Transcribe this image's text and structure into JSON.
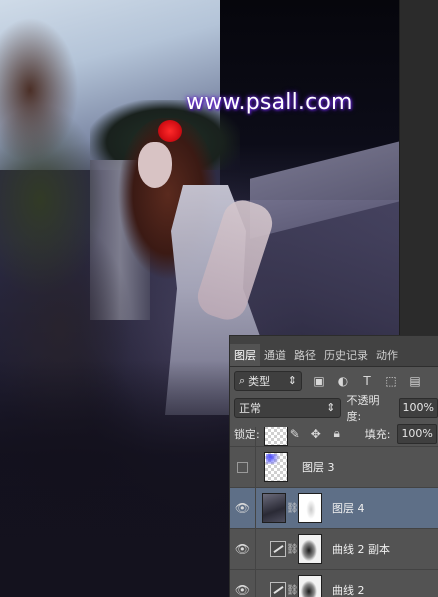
{
  "watermark": "www.psall.com",
  "layers_panel": {
    "tabs": [
      "图层",
      "通道",
      "路径",
      "历史记录",
      "动作"
    ],
    "active_tab": "图层",
    "filter": {
      "label": "类型",
      "icon": "search-icon"
    },
    "filter_icons": [
      "image-icon",
      "adjustment-circle-icon",
      "text-icon",
      "shape-icon",
      "smart-object-icon"
    ],
    "blend_mode": "正常",
    "opacity_label": "不透明度:",
    "opacity_value": "100%",
    "lock_label": "锁定:",
    "lock_icons": [
      "lock-transparency-icon",
      "lock-brush-icon",
      "lock-move-icon",
      "lock-all-icon"
    ],
    "fill_label": "填充:",
    "fill_value": "100%",
    "layers": [
      {
        "name": "图层 3",
        "visible": false,
        "selected": false,
        "type": "pixel"
      },
      {
        "name": "图层 4",
        "visible": true,
        "selected": true,
        "type": "pixel-with-mask"
      },
      {
        "name": "曲线 2 副本",
        "visible": true,
        "selected": false,
        "type": "curves-adjustment"
      },
      {
        "name": "曲线 2",
        "visible": true,
        "selected": false,
        "type": "curves-adjustment"
      }
    ]
  },
  "colors": {
    "panel_bg": "#535353",
    "tab_bar_bg": "#424242",
    "selected_layer": "#5e6f87",
    "watermark_glow": "#6a2fd0"
  }
}
